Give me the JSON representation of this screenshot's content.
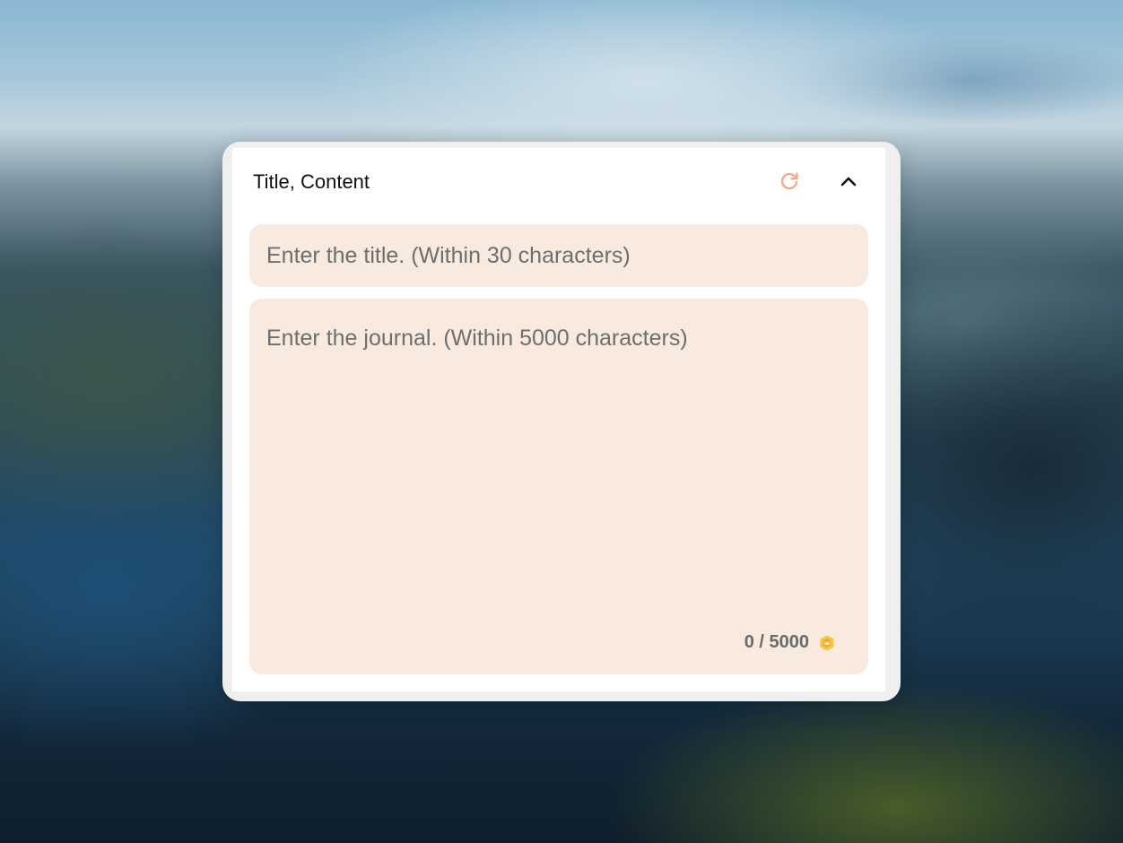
{
  "panel": {
    "title": "Title, Content",
    "refresh_icon": "refresh-icon",
    "collapse_icon": "chevron-up-icon"
  },
  "title_input": {
    "value": "",
    "placeholder": "Enter the title. (Within 30 characters)"
  },
  "journal_input": {
    "value": "",
    "placeholder": "Enter the journal. (Within 5000 characters)",
    "counter": "0 / 5000",
    "counter_icon": "coin-icon"
  },
  "colors": {
    "field_background": "#f8eade",
    "accent": "#f3a98f",
    "coin": "#f5c542"
  }
}
